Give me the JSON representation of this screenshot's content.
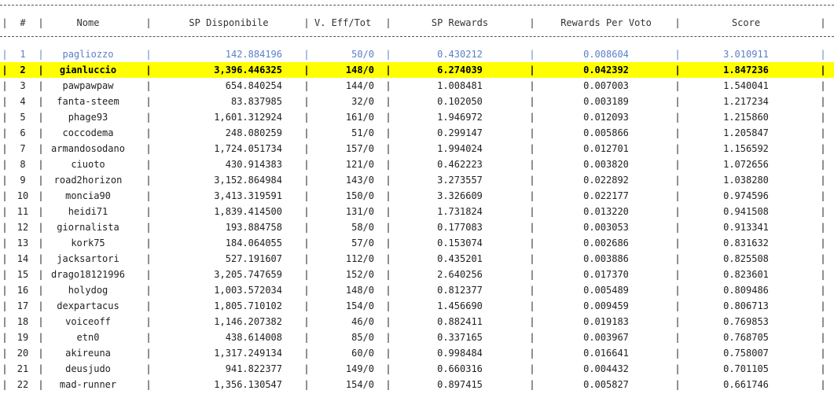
{
  "columns": [
    "#",
    "Nome",
    "SP Disponibile",
    "V. Eff/Tot",
    "SP Rewards",
    "Rewards Per Voto",
    "Score"
  ],
  "highlight_color": "#ffff00",
  "rows": [
    {
      "rank": "1",
      "name": "pagliozzo",
      "sp": "142.884196",
      "votes": "50/0",
      "rewards": "0.430212",
      "per_vote": "0.008604",
      "score": "3.010911"
    },
    {
      "rank": "2",
      "name": "gianluccio",
      "sp": "3,396.446325",
      "votes": "148/0",
      "rewards": "6.274039",
      "per_vote": "0.042392",
      "score": "1.847236"
    },
    {
      "rank": "3",
      "name": "pawpawpaw",
      "sp": "654.840254",
      "votes": "144/0",
      "rewards": "1.008481",
      "per_vote": "0.007003",
      "score": "1.540041"
    },
    {
      "rank": "4",
      "name": "fanta-steem",
      "sp": "83.837985",
      "votes": "32/0",
      "rewards": "0.102050",
      "per_vote": "0.003189",
      "score": "1.217234"
    },
    {
      "rank": "5",
      "name": "phage93",
      "sp": "1,601.312924",
      "votes": "161/0",
      "rewards": "1.946972",
      "per_vote": "0.012093",
      "score": "1.215860"
    },
    {
      "rank": "6",
      "name": "coccodema",
      "sp": "248.080259",
      "votes": "51/0",
      "rewards": "0.299147",
      "per_vote": "0.005866",
      "score": "1.205847"
    },
    {
      "rank": "7",
      "name": "armandosodano",
      "sp": "1,724.051734",
      "votes": "157/0",
      "rewards": "1.994024",
      "per_vote": "0.012701",
      "score": "1.156592"
    },
    {
      "rank": "8",
      "name": "ciuoto",
      "sp": "430.914383",
      "votes": "121/0",
      "rewards": "0.462223",
      "per_vote": "0.003820",
      "score": "1.072656"
    },
    {
      "rank": "9",
      "name": "road2horizon",
      "sp": "3,152.864984",
      "votes": "143/0",
      "rewards": "3.273557",
      "per_vote": "0.022892",
      "score": "1.038280"
    },
    {
      "rank": "10",
      "name": "moncia90",
      "sp": "3,413.319591",
      "votes": "150/0",
      "rewards": "3.326609",
      "per_vote": "0.022177",
      "score": "0.974596"
    },
    {
      "rank": "11",
      "name": "heidi71",
      "sp": "1,839.414500",
      "votes": "131/0",
      "rewards": "1.731824",
      "per_vote": "0.013220",
      "score": "0.941508"
    },
    {
      "rank": "12",
      "name": "giornalista",
      "sp": "193.884758",
      "votes": "58/0",
      "rewards": "0.177083",
      "per_vote": "0.003053",
      "score": "0.913341"
    },
    {
      "rank": "13",
      "name": "kork75",
      "sp": "184.064055",
      "votes": "57/0",
      "rewards": "0.153074",
      "per_vote": "0.002686",
      "score": "0.831632"
    },
    {
      "rank": "14",
      "name": "jacksartori",
      "sp": "527.191607",
      "votes": "112/0",
      "rewards": "0.435201",
      "per_vote": "0.003886",
      "score": "0.825508"
    },
    {
      "rank": "15",
      "name": "drago18121996",
      "sp": "3,205.747659",
      "votes": "152/0",
      "rewards": "2.640256",
      "per_vote": "0.017370",
      "score": "0.823601"
    },
    {
      "rank": "16",
      "name": "holydog",
      "sp": "1,003.572034",
      "votes": "148/0",
      "rewards": "0.812377",
      "per_vote": "0.005489",
      "score": "0.809486"
    },
    {
      "rank": "17",
      "name": "dexpartacus",
      "sp": "1,805.710102",
      "votes": "154/0",
      "rewards": "1.456690",
      "per_vote": "0.009459",
      "score": "0.806713"
    },
    {
      "rank": "18",
      "name": "voiceoff",
      "sp": "1,146.207382",
      "votes": "46/0",
      "rewards": "0.882411",
      "per_vote": "0.019183",
      "score": "0.769853"
    },
    {
      "rank": "19",
      "name": "etn0",
      "sp": "438.614008",
      "votes": "85/0",
      "rewards": "0.337165",
      "per_vote": "0.003967",
      "score": "0.768705"
    },
    {
      "rank": "20",
      "name": "akireuna",
      "sp": "1,317.249134",
      "votes": "60/0",
      "rewards": "0.998484",
      "per_vote": "0.016641",
      "score": "0.758007"
    },
    {
      "rank": "21",
      "name": "deusjudo",
      "sp": "941.822377",
      "votes": "149/0",
      "rewards": "0.660316",
      "per_vote": "0.004432",
      "score": "0.701105"
    },
    {
      "rank": "22",
      "name": "mad-runner",
      "sp": "1,356.130547",
      "votes": "154/0",
      "rewards": "0.897415",
      "per_vote": "0.005827",
      "score": "0.661746"
    }
  ]
}
